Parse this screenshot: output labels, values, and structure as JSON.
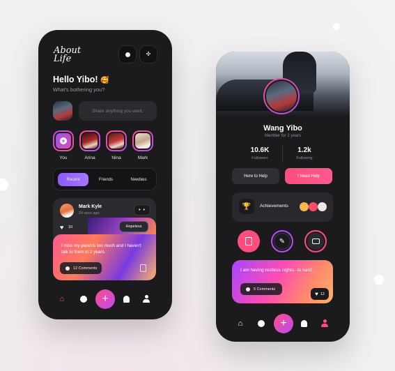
{
  "phone1": {
    "logo": "About Life",
    "greeting": "Hello Yibo!",
    "greeting_emoji": "🥰",
    "subtitle": "What's bothering you?",
    "share_placeholder": "Share anything you want.",
    "stories": [
      {
        "label": "You"
      },
      {
        "label": "Arina"
      },
      {
        "label": "Nina"
      },
      {
        "label": "Mark"
      }
    ],
    "tabs": [
      "Recent",
      "Friends",
      "Newbies"
    ],
    "post": {
      "author": "Mark Kyle",
      "time": "24 secs ago",
      "tag": "Hopeless",
      "likes": "10",
      "text": "I miss my parents too much and I haven't talk to them in 2 years.",
      "comments": "12 Comments"
    }
  },
  "phone2": {
    "name": "Wang Yibo",
    "member": "Member for 2 years",
    "followers_value": "10.6K",
    "followers_label": "Followers",
    "following_value": "1.2k",
    "following_label": "Following",
    "btn_help": "Here to Help",
    "btn_need": "I Need Help",
    "achievements": "Achievements",
    "post": {
      "text": "I am having restless nights. Its hard.",
      "comments": "5 Comments",
      "likes": "12"
    }
  },
  "colors": {
    "accent_pink": "#ff4d8a",
    "accent_purple": "#8a5bf5",
    "phone_bg": "#1b1b1e"
  }
}
